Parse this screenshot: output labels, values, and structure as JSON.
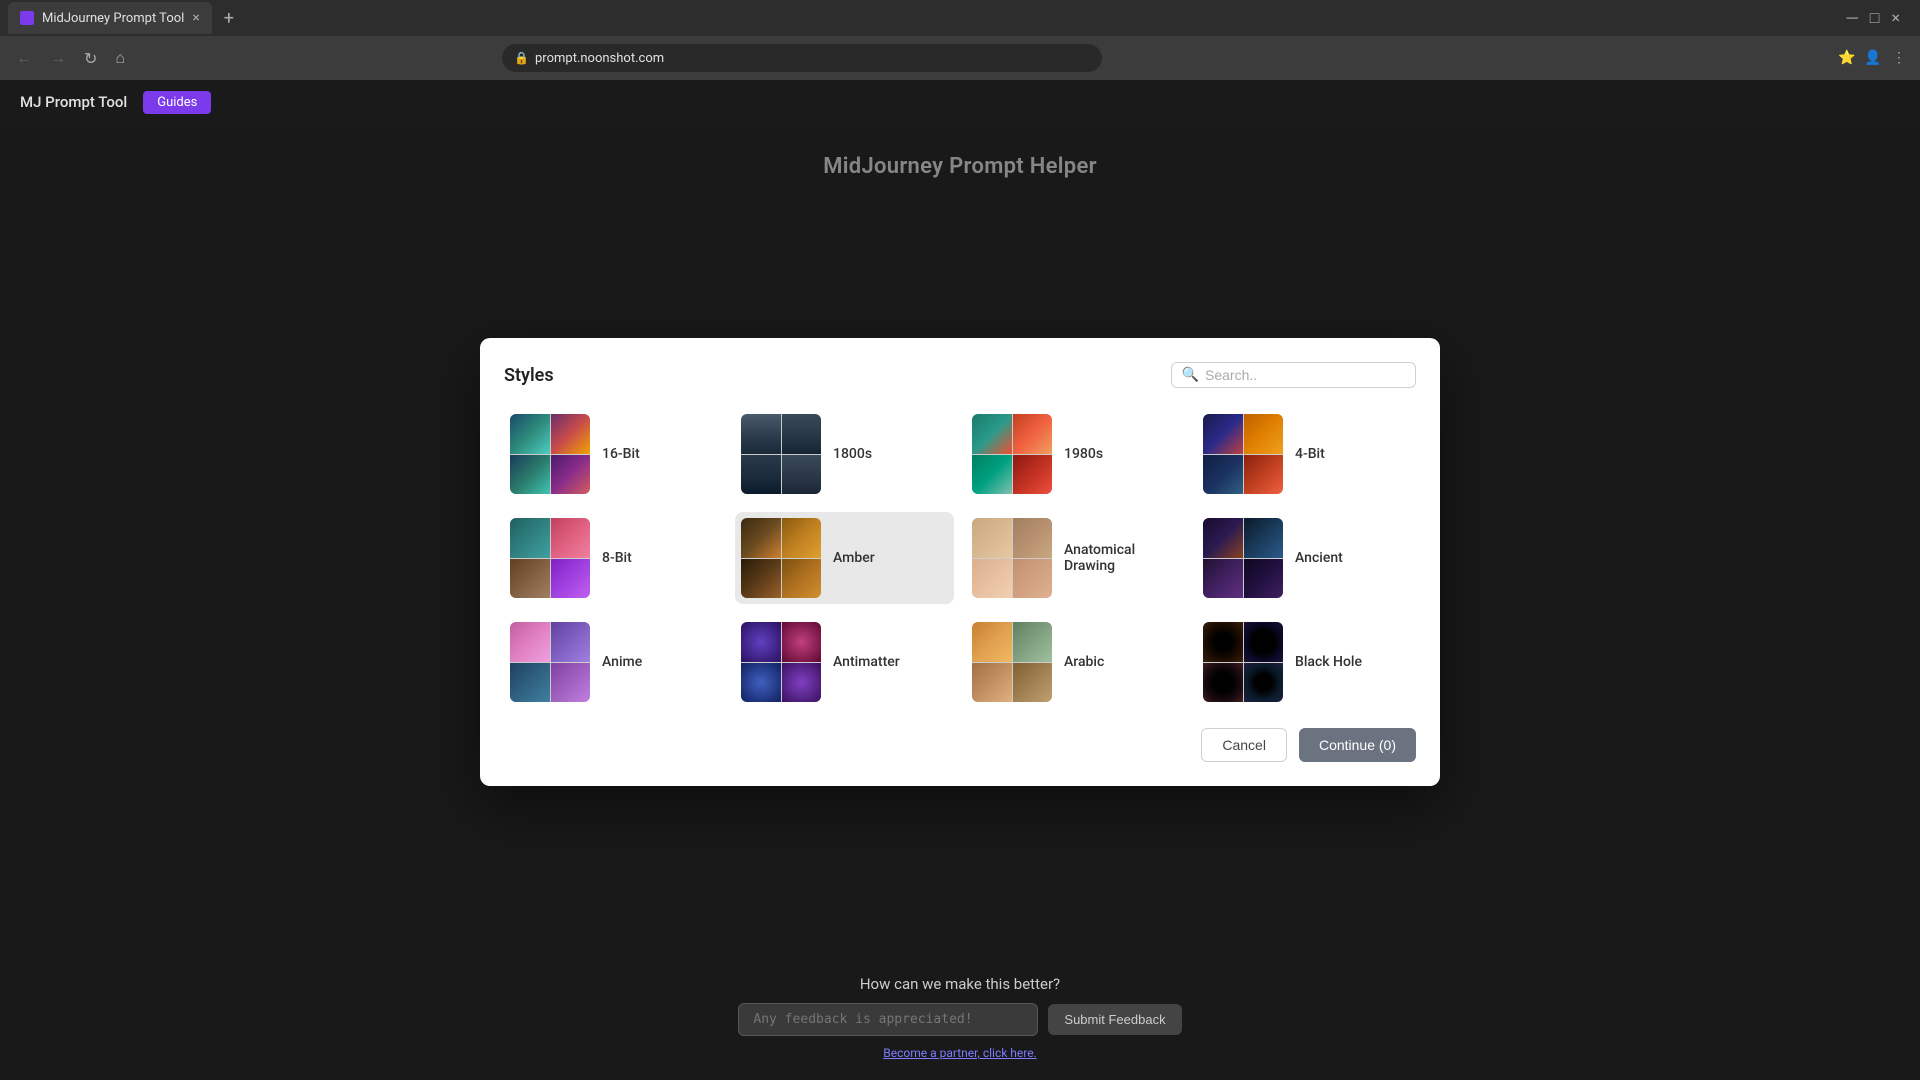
{
  "browser": {
    "tab_title": "MidJourney Prompt Tool",
    "url": "prompt.noonshot.com",
    "tab_close": "×",
    "tab_new": "+"
  },
  "navbar": {
    "logo": "MJ Prompt Tool",
    "guides_label": "Guides"
  },
  "page": {
    "title": "MidJourney Prompt Helper"
  },
  "modal": {
    "title": "Styles",
    "search_placeholder": "Search..",
    "cancel_label": "Cancel",
    "continue_label": "Continue (0)",
    "items": [
      {
        "id": "16bit",
        "label": "16-Bit",
        "thumb_class": "thumb-16bit"
      },
      {
        "id": "1800s",
        "label": "1800s",
        "thumb_class": "thumb-1800s"
      },
      {
        "id": "1980s",
        "label": "1980s",
        "thumb_class": "thumb-1980s"
      },
      {
        "id": "4bit",
        "label": "4-Bit",
        "thumb_class": "thumb-4bit"
      },
      {
        "id": "8bit",
        "label": "8-Bit",
        "thumb_class": "thumb-8bit"
      },
      {
        "id": "amber",
        "label": "Amber",
        "thumb_class": "thumb-amber",
        "hovered": true
      },
      {
        "id": "anatomical-drawing",
        "label": "Anatomical Drawing",
        "thumb_class": "thumb-anatdrawing"
      },
      {
        "id": "ancient",
        "label": "Ancient",
        "thumb_class": "thumb-ancient"
      },
      {
        "id": "anime",
        "label": "Anime",
        "thumb_class": "thumb-anime"
      },
      {
        "id": "antimatter",
        "label": "Antimatter",
        "thumb_class": "thumb-antimatter"
      },
      {
        "id": "arabic",
        "label": "Arabic",
        "thumb_class": "thumb-arabic"
      },
      {
        "id": "black-hole",
        "label": "Black Hole",
        "thumb_class": "thumb-blackhole"
      }
    ]
  },
  "feedback": {
    "title": "How can we make this better?",
    "placeholder": "Any feedback is appreciated!",
    "submit_label": "Submit Feedback",
    "partner_link": "Become a partner, click here."
  }
}
